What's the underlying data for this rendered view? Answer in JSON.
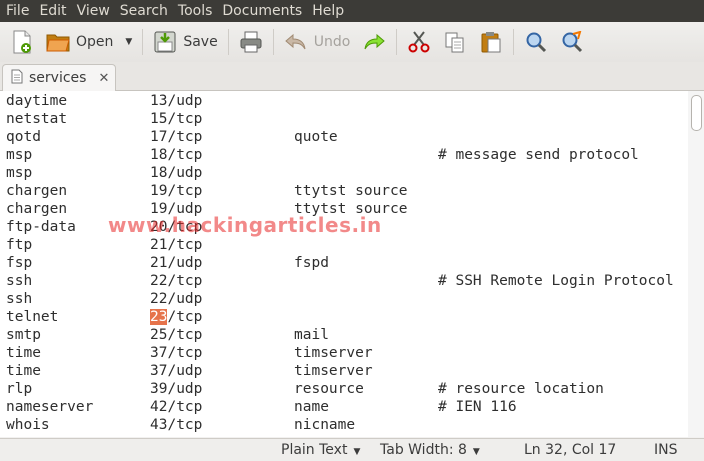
{
  "menu": [
    "File",
    "Edit",
    "View",
    "Search",
    "Tools",
    "Documents",
    "Help"
  ],
  "toolbar": {
    "open_label": "Open",
    "save_label": "Save",
    "undo_label": "Undo",
    "icons": {
      "new": "new-document-icon",
      "open": "folder-open-icon",
      "open_menu": "chevron-down-icon",
      "save": "save-icon",
      "print": "printer-icon",
      "undo": "undo-icon",
      "redo": "redo-icon",
      "cut": "scissors-icon",
      "copy": "copy-icon",
      "paste": "paste-icon",
      "find": "search-icon",
      "replace": "find-replace-icon"
    }
  },
  "tab": {
    "name": "services",
    "close": "✕"
  },
  "editor": {
    "highlight_color": "#e6734b",
    "lines": [
      {
        "c1": "daytime",
        "c2": "13/udp",
        "c3": "",
        "c4": ""
      },
      {
        "c1": "netstat",
        "c2": "15/tcp",
        "c3": "",
        "c4": ""
      },
      {
        "c1": "qotd",
        "c2": "17/tcp",
        "c3": "quote",
        "c4": ""
      },
      {
        "c1": "msp",
        "c2": "18/tcp",
        "c3": "",
        "c4": "# message send protocol"
      },
      {
        "c1": "msp",
        "c2": "18/udp",
        "c3": "",
        "c4": ""
      },
      {
        "c1": "chargen",
        "c2": "19/tcp",
        "c3": "ttytst source",
        "c4": ""
      },
      {
        "c1": "chargen",
        "c2": "19/udp",
        "c3": "ttytst source",
        "c4": ""
      },
      {
        "c1": "ftp-data",
        "c2": "20/tcp",
        "c3": "",
        "c4": ""
      },
      {
        "c1": "ftp",
        "c2": "21/tcp",
        "c3": "",
        "c4": ""
      },
      {
        "c1": "fsp",
        "c2": "21/udp",
        "c3": "fspd",
        "c4": ""
      },
      {
        "c1": "ssh",
        "c2": "22/tcp",
        "c3": "",
        "c4": "# SSH Remote Login Protocol"
      },
      {
        "c1": "ssh",
        "c2": "22/udp",
        "c3": "",
        "c4": ""
      },
      {
        "c1": "telnet",
        "c2_hl": "23",
        "c2_rest": "/tcp",
        "c3": "",
        "c4": ""
      },
      {
        "c1": "smtp",
        "c2": "25/tcp",
        "c3": "mail",
        "c4": ""
      },
      {
        "c1": "time",
        "c2": "37/tcp",
        "c3": "timserver",
        "c4": ""
      },
      {
        "c1": "time",
        "c2": "37/udp",
        "c3": "timserver",
        "c4": ""
      },
      {
        "c1": "rlp",
        "c2": "39/udp",
        "c3": "resource",
        "c4": "# resource location"
      },
      {
        "c1": "nameserver",
        "c2": "42/tcp",
        "c3": "name",
        "c4": "# IEN 116"
      },
      {
        "c1": "whois",
        "c2": "43/tcp",
        "c3": "nicname",
        "c4": ""
      }
    ]
  },
  "watermark": "www.hackingarticles.in",
  "statusbar": {
    "syntax": "Plain Text",
    "tab_width": "Tab Width: 8",
    "position": "Ln 32, Col 17",
    "mode": "INS"
  }
}
